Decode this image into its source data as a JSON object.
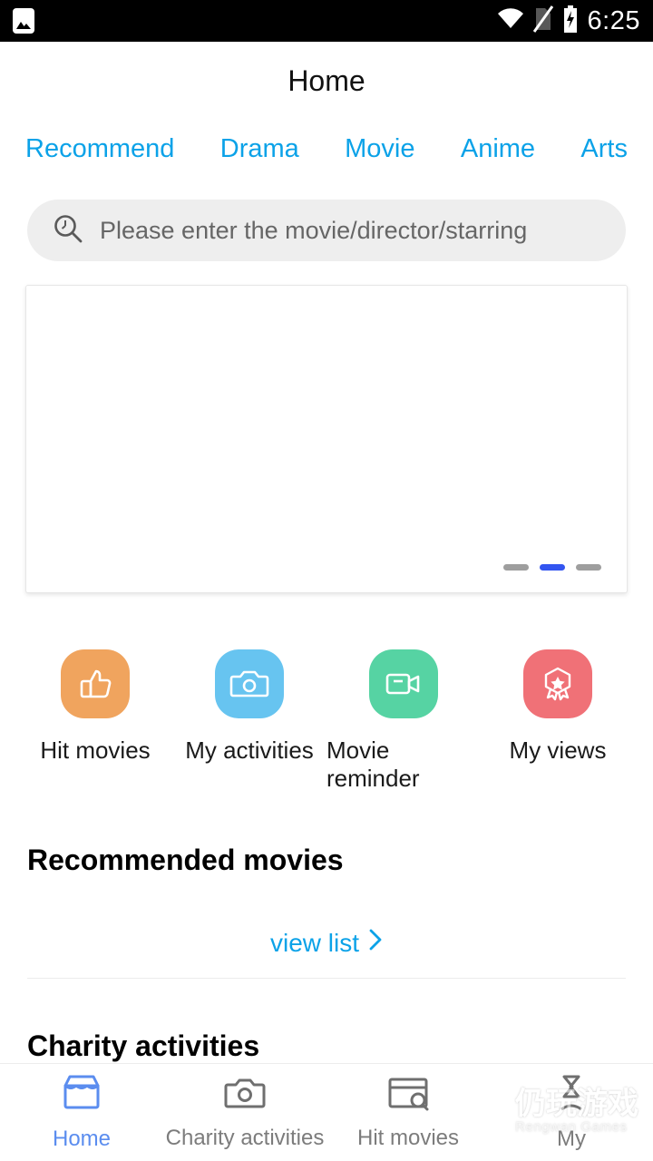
{
  "status_bar": {
    "notification_icon": "photo-icon",
    "wifi_icon": "wifi-icon",
    "signal_icon": "no-sim-icon",
    "battery_icon": "battery-charging-icon",
    "time": "6:25"
  },
  "header": {
    "title": "Home"
  },
  "tabs": [
    {
      "label": "Recommend",
      "active": true
    },
    {
      "label": "Drama",
      "active": false
    },
    {
      "label": "Movie",
      "active": false
    },
    {
      "label": "Anime",
      "active": false
    },
    {
      "label": "Arts",
      "active": false
    }
  ],
  "search": {
    "icon": "search-icon",
    "placeholder": "Please enter the movie/director/starring",
    "value": ""
  },
  "carousel": {
    "dots_total": 3,
    "active_dot_index": 1,
    "active_color": "#3355f0",
    "inactive_color": "#9e9e9e"
  },
  "quick_actions": [
    {
      "label": "Hit movies",
      "icon": "thumbs-up-icon",
      "color": "#F0A45E"
    },
    {
      "label": "My activities",
      "icon": "camera-icon",
      "color": "#67C4F0"
    },
    {
      "label": "Movie reminder",
      "icon": "video-camera-icon",
      "color": "#56D3A3"
    },
    {
      "label": "My views",
      "icon": "medal-badge-icon",
      "color": "#F07177"
    }
  ],
  "sections": {
    "recommended_title": "Recommended movies",
    "view_list_label": "view list",
    "view_list_icon": "chevron-right-icon",
    "charity_title": "Charity activities"
  },
  "bottom_nav": [
    {
      "label": "Home",
      "icon": "store-box-icon",
      "active": true
    },
    {
      "label": "Charity activities",
      "icon": "camera-icon",
      "active": false
    },
    {
      "label": "Hit movies",
      "icon": "window-search-icon",
      "active": false
    },
    {
      "label": "My",
      "icon": "person-icon",
      "active": false
    }
  ],
  "watermark": {
    "cn": "仍玩游戏",
    "en": "Rengwan Games",
    "logo": "rengwan-logo-icon"
  },
  "colors": {
    "accent_blue": "#0BA2E8",
    "nav_active": "#5B8DEF"
  }
}
